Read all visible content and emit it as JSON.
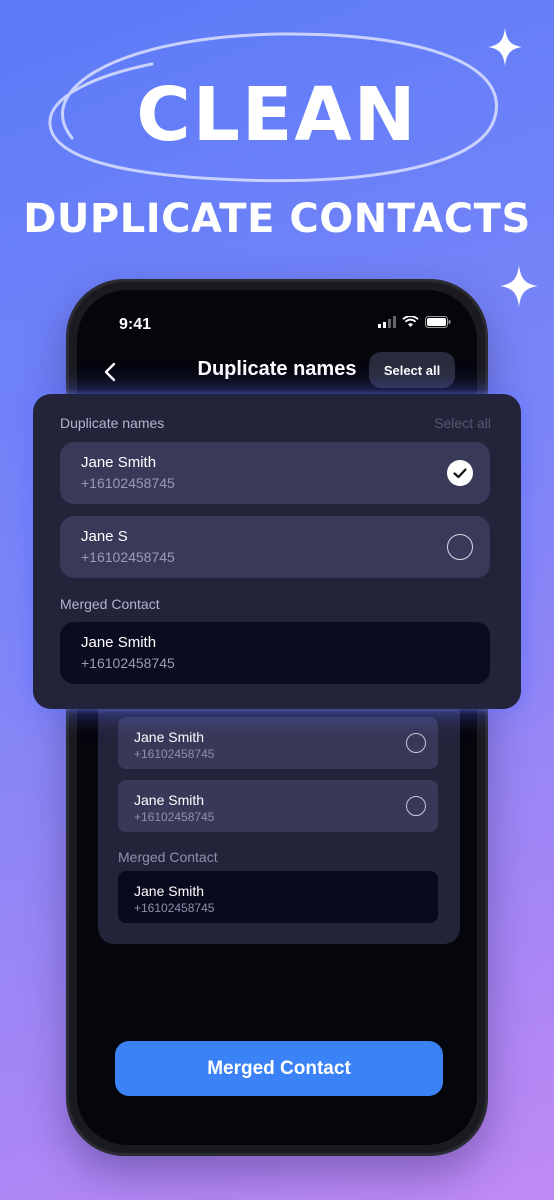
{
  "hero": {
    "headline": "CLEAN",
    "subheadline": "DUPLICATE CONTACTS"
  },
  "status_bar": {
    "time": "9:41"
  },
  "nav": {
    "title": "Duplicate names",
    "select_all": "Select all"
  },
  "card": {
    "title": "Duplicate names",
    "select_all": "Select all",
    "rows": [
      {
        "name": "Jane Smith",
        "phone": "+16102458745",
        "selected": true
      },
      {
        "name": "Jane S",
        "phone": "+16102458745",
        "selected": false
      }
    ],
    "merged_label": "Merged Contact",
    "merged": {
      "name": "Jane Smith",
      "phone": "+16102458745"
    }
  },
  "background_group": {
    "rows": [
      {
        "name": "Jane Smith",
        "phone": "+16102458745",
        "selected": false
      },
      {
        "name": "Jane Smith",
        "phone": "+16102458745",
        "selected": false
      }
    ],
    "merged_label": "Merged Contact",
    "merged": {
      "name": "Jane Smith",
      "phone": "+16102458745"
    }
  },
  "primary_button": {
    "label": "Merged Contact"
  },
  "colors": {
    "accent": "#3b82f6",
    "card_bg": "#23243a",
    "row_bg": "#393a5a",
    "merged_bg": "#0b0c1f",
    "screen_bg": "#05050c"
  }
}
